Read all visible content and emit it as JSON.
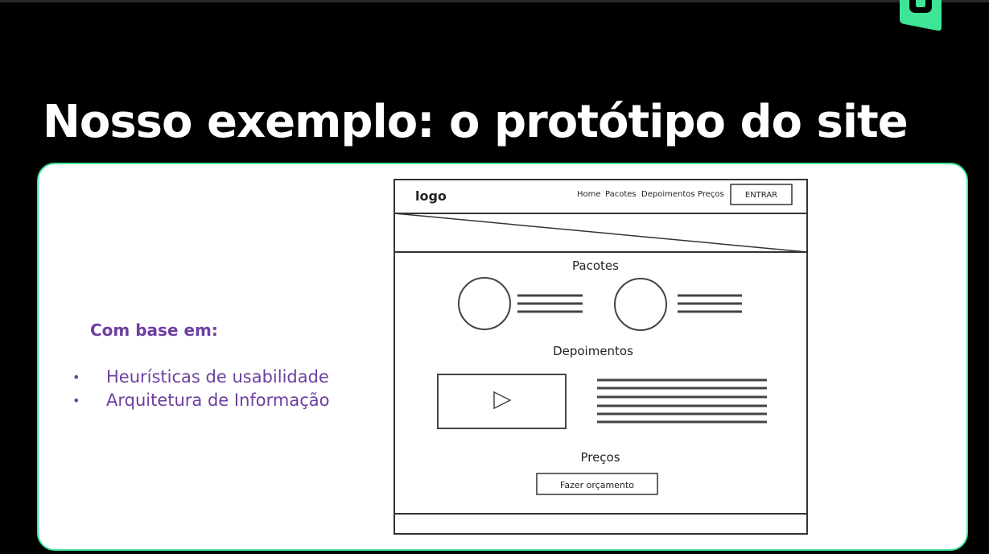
{
  "slide": {
    "title": "Nosso exemplo: o protótipo do site",
    "basis_heading": "Com base em:",
    "criteria": [
      "Heurísticas de usabilidade",
      "Arquitetura de Informação"
    ]
  },
  "brand": {
    "accent_color": "#3ee597",
    "text_color": "#6d3fa0",
    "logo_icon": "brand-logo-icon"
  },
  "wireframe": {
    "logo": "logo",
    "nav_items": [
      "Home",
      "Pacotes",
      "Depoimentos",
      "Preços"
    ],
    "login_button": "ENTRAR",
    "sections": {
      "packages": "Pacotes",
      "testimonials": "Depoimentos",
      "prices": "Preços"
    },
    "quote_button": "Fazer orçamento",
    "video_icon": "play-icon"
  }
}
